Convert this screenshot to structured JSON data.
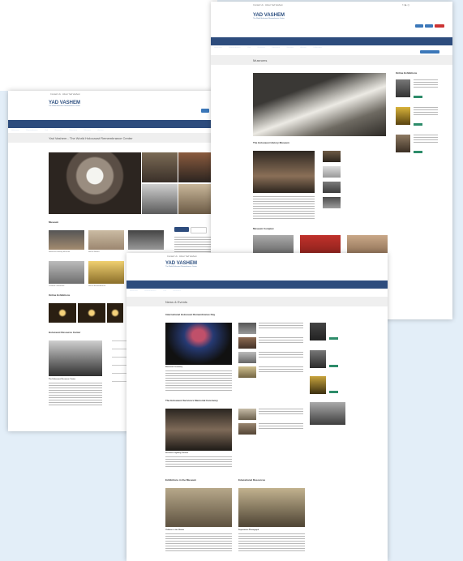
{
  "site": {
    "logo_text": "יד ושם",
    "logo_sub": "YAD VASHEM",
    "logo_tagline": "The World Holocaust Remembrance Center",
    "top_links": [
      "Contact Us",
      "About Yad Vashem"
    ],
    "nav_items": [
      "Holocaust",
      "Remembrance",
      "Visit",
      "Research",
      "Education",
      "Museum",
      "Archive",
      "Collections",
      "Events"
    ]
  },
  "page_home": {
    "title": "Yad Vashem - The World Holocaust Remembrance Center",
    "section_1": "Museum",
    "section_2": "Online Exhibitions",
    "section_3": "Holocaust Resource Center",
    "article_caption": "The Holocaust Resource Center",
    "captions": [
      "Holocaust History Museum",
      "Hall of Names",
      "Children's Memorial",
      "Hall of Remembrance",
      "Valley of the Communities",
      "Righteous Among the Nations"
    ],
    "search_btn": "Search"
  },
  "page_museum": {
    "title": "Museums",
    "section_1": "The Holocaust History Museum",
    "section_2": "Museum Complex",
    "section_3": "Galleries",
    "sidebar_title": "Online Exhibitions",
    "captions": [
      "Hall of Names",
      "Children's Memorial",
      "Art Museum",
      "Visual Center",
      "Synagogue",
      "Exhibitions Pavilion",
      "Hall of Remembrance"
    ],
    "read_more": "Read More",
    "lang_buttons": [
      "Hebrew",
      "Russian",
      "Donate"
    ]
  },
  "page_news": {
    "title": "News & Events",
    "section_1": "International Holocaust Remembrance Day",
    "section_2": "The Holocaust Survivors Memorial Ceremony",
    "section_3": "Exhibitions in the Museum",
    "section_4": "Educational Resources",
    "captions": [
      "Memorial Ceremony",
      "Survivors Lighting Torches",
      "Children in the Ghetto",
      "Deportation Photograph"
    ]
  },
  "colors": {
    "brand_blue": "#2d4c7d",
    "accent_green": "#2d8c6a",
    "accent_red": "#c33",
    "background": "#e3eef8"
  },
  "icons": [
    "search-icon",
    "facebook-icon",
    "twitter-icon",
    "youtube-icon",
    "instagram-icon"
  ]
}
